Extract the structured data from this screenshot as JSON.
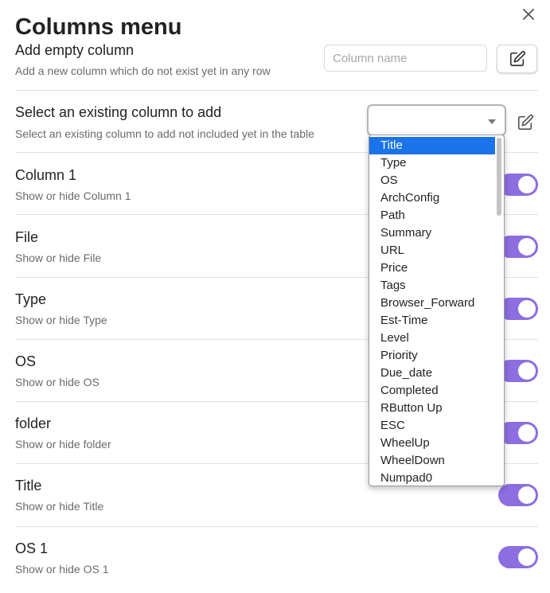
{
  "modal": {
    "title": "Columns menu",
    "close_icon": "close-icon"
  },
  "add_empty": {
    "title": "Add empty column",
    "description": "Add a new column which do not exist yet in any row",
    "input_placeholder": "Column name",
    "input_value": "",
    "button_icon": "edit-icon"
  },
  "existing": {
    "title": "Select an existing column to add",
    "description": "Select an existing column to add not included yet in the table",
    "selected": "",
    "button_icon": "edit-icon",
    "options": [
      "Title",
      "Type",
      "OS",
      "ArchConfig",
      "Path",
      "Summary",
      "URL",
      "Price",
      "Tags",
      "Browser_Forward",
      "Est-Time",
      "Level",
      "Priority",
      "Due_date",
      "Completed",
      "RButton Up",
      "ESC",
      "WheelUp",
      "WheelDown",
      "Numpad0"
    ],
    "highlighted_index": 0
  },
  "columns": [
    {
      "title": "Column 1",
      "description": "Show or hide Column 1",
      "enabled": true
    },
    {
      "title": "File",
      "description": "Show or hide File",
      "enabled": true
    },
    {
      "title": "Type",
      "description": "Show or hide Type",
      "enabled": true
    },
    {
      "title": "OS",
      "description": "Show or hide OS",
      "enabled": true
    },
    {
      "title": "folder",
      "description": "Show or hide folder",
      "enabled": true
    },
    {
      "title": "Title",
      "description": "Show or hide Title",
      "enabled": true
    },
    {
      "title": "OS 1",
      "description": "Show or hide OS 1",
      "enabled": true
    }
  ],
  "colors": {
    "toggle_on": "#8c6ee0",
    "highlight": "#1a73e8",
    "divider": "#e0e0e0"
  }
}
